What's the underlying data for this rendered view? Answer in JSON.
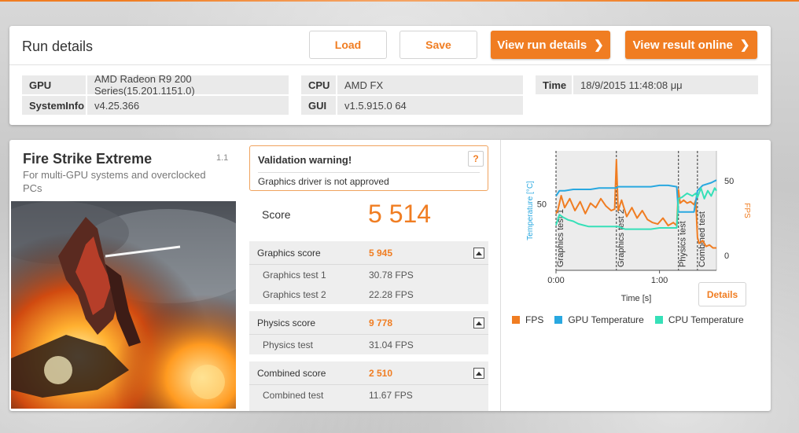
{
  "run": {
    "title": "Run details",
    "load_label": "Load",
    "save_label": "Save",
    "view_run_details_label": "View run details",
    "view_result_online_label": "View result online",
    "gpu_label": "GPU",
    "gpu_value": "AMD Radeon R9 200 Series(15.201.1151.0)",
    "sysinfo_label": "SystemInfo",
    "sysinfo_value": "v4.25.366",
    "cpu_label": "CPU",
    "cpu_value": "AMD FX",
    "gui_label": "GUI",
    "gui_value": "v1.5.915.0 64",
    "time_label": "Time",
    "time_value": "18/9/2015 11:48:08 μμ"
  },
  "test": {
    "name": "Fire Strike Extreme",
    "version": "1.1",
    "description": "For multi-GPU systems and overclocked PCs"
  },
  "validation": {
    "title": "Validation warning!",
    "message": "Graphics driver is not approved",
    "help": "?"
  },
  "score": {
    "label": "Score",
    "value": "5 514"
  },
  "graphics": {
    "label": "Graphics score",
    "value": "5 945",
    "tests": [
      {
        "label": "Graphics test 1",
        "value": "30.78 FPS"
      },
      {
        "label": "Graphics test 2",
        "value": "22.28 FPS"
      }
    ]
  },
  "physics": {
    "label": "Physics score",
    "value": "9 778",
    "tests": [
      {
        "label": "Physics test",
        "value": "31.04 FPS"
      }
    ]
  },
  "combined": {
    "label": "Combined score",
    "value": "2 510",
    "tests": [
      {
        "label": "Combined test",
        "value": "11.67 FPS"
      }
    ]
  },
  "chart": {
    "details_label": "Details",
    "colors": {
      "fps": "#f07d22",
      "gpu_temp": "#29a8e0",
      "cpu_temp": "#36e0b8"
    }
  },
  "chart_data": {
    "type": "line",
    "xlabel": "Time [s]",
    "ylabel_left": "Temperature [°C]",
    "ylabel_right": "FPS",
    "x_ticks": [
      "0:00",
      "1:00"
    ],
    "x_ticks_seconds": [
      0,
      60
    ],
    "xlim": [
      0,
      93
    ],
    "y_left_ticks": [
      50
    ],
    "y_left_lim": [
      0,
      90
    ],
    "y_right_ticks": [
      0,
      50
    ],
    "y_right_lim": [
      -10,
      70
    ],
    "sections": [
      {
        "label": "Graphics test 1",
        "start": 0,
        "end": 35
      },
      {
        "label": "Graphics test 2",
        "start": 35,
        "end": 71
      },
      {
        "label": "Physics test",
        "start": 71,
        "end": 82
      },
      {
        "label": "Combined test",
        "start": 82,
        "end": 93
      }
    ],
    "series": [
      {
        "name": "FPS",
        "axis": "right",
        "x": [
          0,
          1,
          3,
          5,
          8,
          11,
          14,
          17,
          20,
          23,
          26,
          29,
          32,
          34,
          35,
          36,
          38,
          41,
          44,
          47,
          50,
          53,
          56,
          59,
          62,
          65,
          68,
          70,
          71,
          72,
          74,
          76,
          78,
          80,
          81,
          82,
          83,
          85,
          87,
          89,
          91,
          93
        ],
        "values": [
          28,
          30,
          40,
          32,
          38,
          30,
          36,
          28,
          35,
          32,
          38,
          33,
          30,
          31,
          64,
          30,
          37,
          26,
          32,
          25,
          30,
          24,
          22,
          21,
          25,
          20,
          22,
          20,
          44,
          35,
          37,
          35,
          36,
          34,
          37,
          12,
          8,
          10,
          6,
          7,
          5,
          5
        ]
      },
      {
        "name": "GPU Temperature",
        "axis": "left",
        "x": [
          0,
          2,
          5,
          10,
          15,
          20,
          25,
          30,
          35,
          36,
          40,
          45,
          50,
          55,
          60,
          65,
          70,
          71,
          75,
          80,
          82,
          85,
          90,
          93
        ],
        "values": [
          56,
          60,
          60,
          61,
          61,
          61,
          62,
          62,
          62,
          63,
          63,
          63,
          63,
          63,
          64,
          64,
          63,
          44,
          44,
          44,
          60,
          64,
          66,
          68
        ]
      },
      {
        "name": "CPU Temperature",
        "axis": "left",
        "x": [
          0,
          2,
          4,
          7,
          10,
          13,
          16,
          19,
          22,
          25,
          28,
          31,
          34,
          35,
          36,
          40,
          45,
          50,
          55,
          60,
          65,
          70,
          71,
          73,
          76,
          79,
          81,
          82,
          84,
          86,
          88,
          90,
          92,
          93
        ],
        "values": [
          34,
          42,
          40,
          38,
          37,
          35,
          34,
          33,
          33,
          33,
          33,
          33,
          33,
          33,
          33,
          31,
          31,
          31,
          31,
          32,
          32,
          32,
          54,
          55,
          58,
          56,
          58,
          55,
          62,
          54,
          60,
          56,
          62,
          60
        ]
      }
    ]
  }
}
